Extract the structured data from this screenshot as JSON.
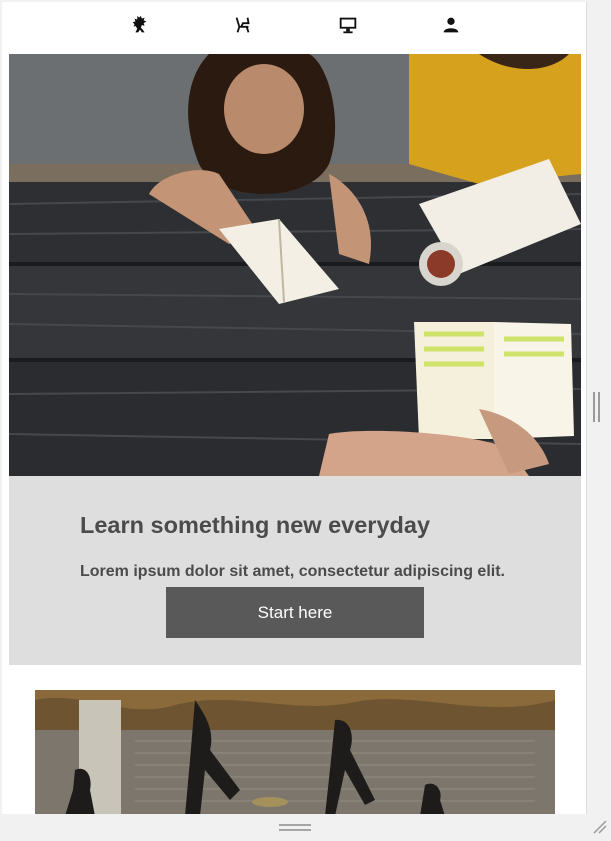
{
  "nav": {
    "items": [
      {
        "icon": "lion-icon"
      },
      {
        "icon": "chair-icon"
      },
      {
        "icon": "monitor-icon"
      },
      {
        "icon": "user-icon"
      }
    ]
  },
  "hero": {
    "image": "students-reading-at-table-photo",
    "title": "Learn something new everyday",
    "subtitle": "Lorem ipsum dolor sit amet, consectetur adipiscing elit.",
    "button_label": "Start here",
    "panel_color": "#dedede",
    "button_color": "#595959"
  },
  "second_section": {
    "image": "people-shadows-on-pavement-photo"
  }
}
